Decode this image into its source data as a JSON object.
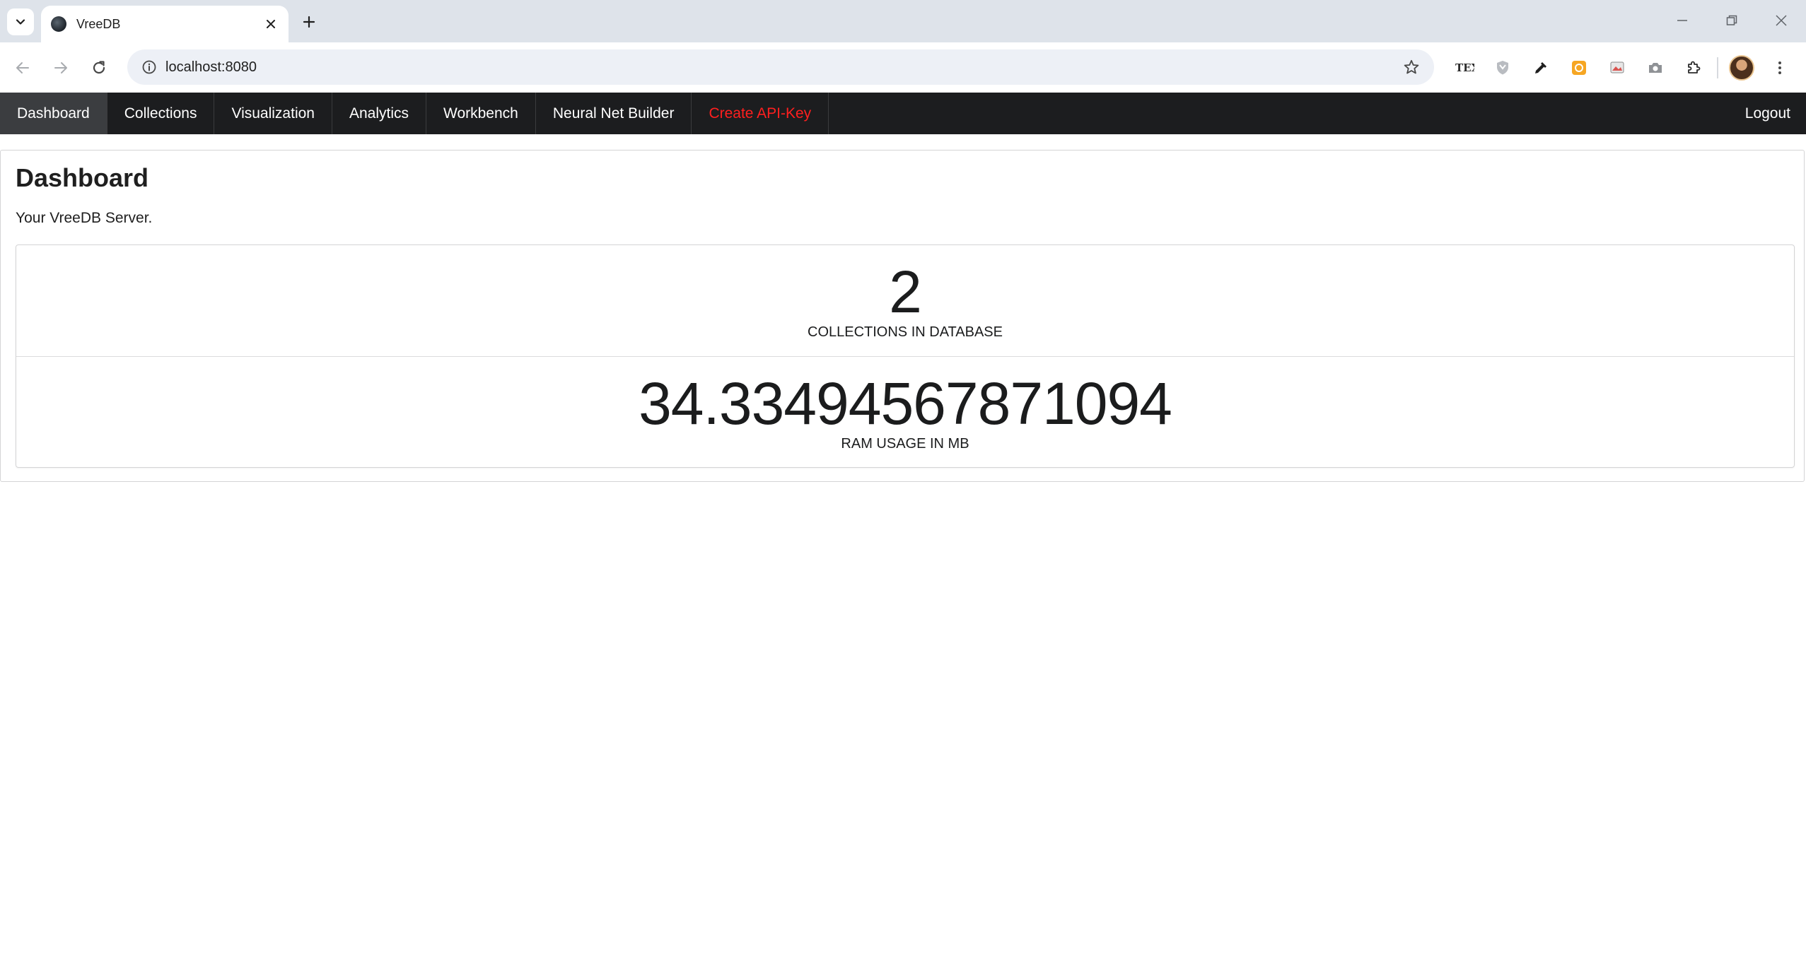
{
  "browser": {
    "tab_title": "VreeDB",
    "url": "localhost:8080"
  },
  "navbar": {
    "items": [
      {
        "label": "Dashboard",
        "active": true
      },
      {
        "label": "Collections"
      },
      {
        "label": "Visualization"
      },
      {
        "label": "Analytics"
      },
      {
        "label": "Workbench"
      },
      {
        "label": "Neural Net Builder"
      },
      {
        "label": "Create API-Key",
        "color": "#ff1f1f"
      }
    ],
    "logout_label": "Logout"
  },
  "page": {
    "title": "Dashboard",
    "subtitle": "Your VreeDB Server."
  },
  "stats": [
    {
      "value": "2",
      "label": "COLLECTIONS IN DATABASE"
    },
    {
      "value": "34.33494567871094",
      "label": "RAM USAGE IN MB"
    }
  ],
  "colors": {
    "navbar_bg": "#1c1d1f",
    "navbar_active": "#3b3d40",
    "danger": "#ff1f1f"
  }
}
